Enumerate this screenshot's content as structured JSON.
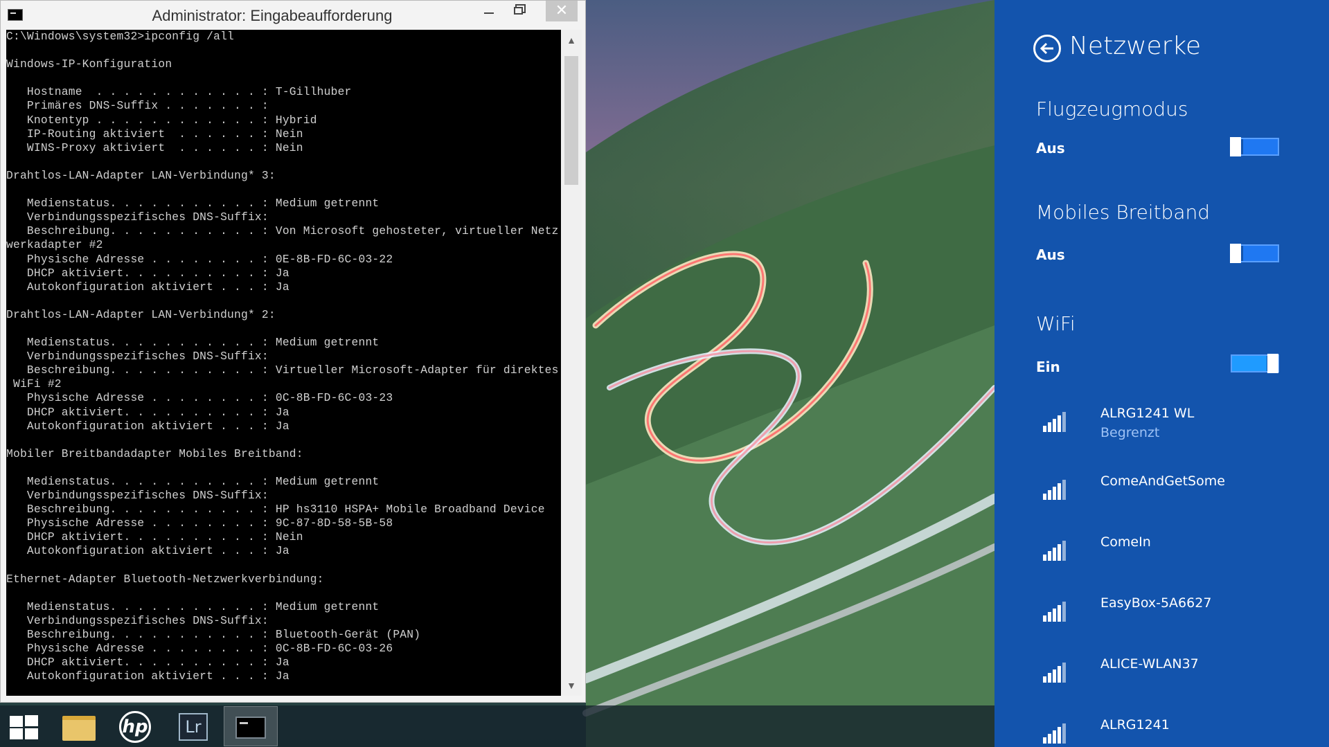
{
  "cmd_window": {
    "title": "Administrator: Eingabeaufforderung",
    "output": "C:\\Windows\\system32>ipconfig /all\n\nWindows-IP-Konfiguration\n\n   Hostname  . . . . . . . . . . . . : T-Gillhuber\n   Primäres DNS-Suffix . . . . . . . :\n   Knotentyp . . . . . . . . . . . . : Hybrid\n   IP-Routing aktiviert  . . . . . . : Nein\n   WINS-Proxy aktiviert  . . . . . . : Nein\n\nDrahtlos-LAN-Adapter LAN-Verbindung* 3:\n\n   Medienstatus. . . . . . . . . . . : Medium getrennt\n   Verbindungsspezifisches DNS-Suffix:\n   Beschreibung. . . . . . . . . . . : Von Microsoft gehosteter, virtueller Netz\nwerkadapter #2\n   Physische Adresse . . . . . . . . : 0E-8B-FD-6C-03-22\n   DHCP aktiviert. . . . . . . . . . : Ja\n   Autokonfiguration aktiviert . . . : Ja\n\nDrahtlos-LAN-Adapter LAN-Verbindung* 2:\n\n   Medienstatus. . . . . . . . . . . : Medium getrennt\n   Verbindungsspezifisches DNS-Suffix:\n   Beschreibung. . . . . . . . . . . : Virtueller Microsoft-Adapter für direktes\n WiFi #2\n   Physische Adresse . . . . . . . . : 0C-8B-FD-6C-03-23\n   DHCP aktiviert. . . . . . . . . . : Ja\n   Autokonfiguration aktiviert . . . : Ja\n\nMobiler Breitbandadapter Mobiles Breitband:\n\n   Medienstatus. . . . . . . . . . . : Medium getrennt\n   Verbindungsspezifisches DNS-Suffix:\n   Beschreibung. . . . . . . . . . . : HP hs3110 HSPA+ Mobile Broadband Device\n   Physische Adresse . . . . . . . . : 9C-87-8D-58-5B-58\n   DHCP aktiviert. . . . . . . . . . : Nein\n   Autokonfiguration aktiviert . . . : Ja\n\nEthernet-Adapter Bluetooth-Netzwerkverbindung:\n\n   Medienstatus. . . . . . . . . . . : Medium getrennt\n   Verbindungsspezifisches DNS-Suffix:\n   Beschreibung. . . . . . . . . . . : Bluetooth-Gerät (PAN)\n   Physische Adresse . . . . . . . . : 0C-8B-FD-6C-03-26\n   DHCP aktiviert. . . . . . . . . . : Ja\n   Autokonfiguration aktiviert . . . : Ja"
  },
  "taskbar": {
    "lightroom_label": "Lr",
    "hp_label": "hp",
    "items": [
      "start-icon",
      "file-explorer-icon",
      "hp-icon",
      "lightroom-icon",
      "command-prompt-icon"
    ]
  },
  "network_panel": {
    "title": "Netzwerke",
    "flight_mode": {
      "title": "Flugzeugmodus",
      "state": "Aus"
    },
    "mobile_broadband": {
      "title": "Mobiles Breitband",
      "state": "Aus"
    },
    "wifi": {
      "title": "WiFi",
      "state": "Ein"
    },
    "networks": [
      {
        "name": "ALRG1241 WL",
        "status": "Begrenzt"
      },
      {
        "name": "ComeAndGetSome",
        "status": ""
      },
      {
        "name": "ComeIn",
        "status": ""
      },
      {
        "name": "EasyBox-5A6627",
        "status": ""
      },
      {
        "name": "ALICE-WLAN37",
        "status": ""
      },
      {
        "name": "ALRG1241",
        "status": ""
      }
    ],
    "colors": {
      "panel": "#1354ad",
      "toggle_on": "#1f9bff",
      "toggle_off": "#1f78f2"
    }
  }
}
